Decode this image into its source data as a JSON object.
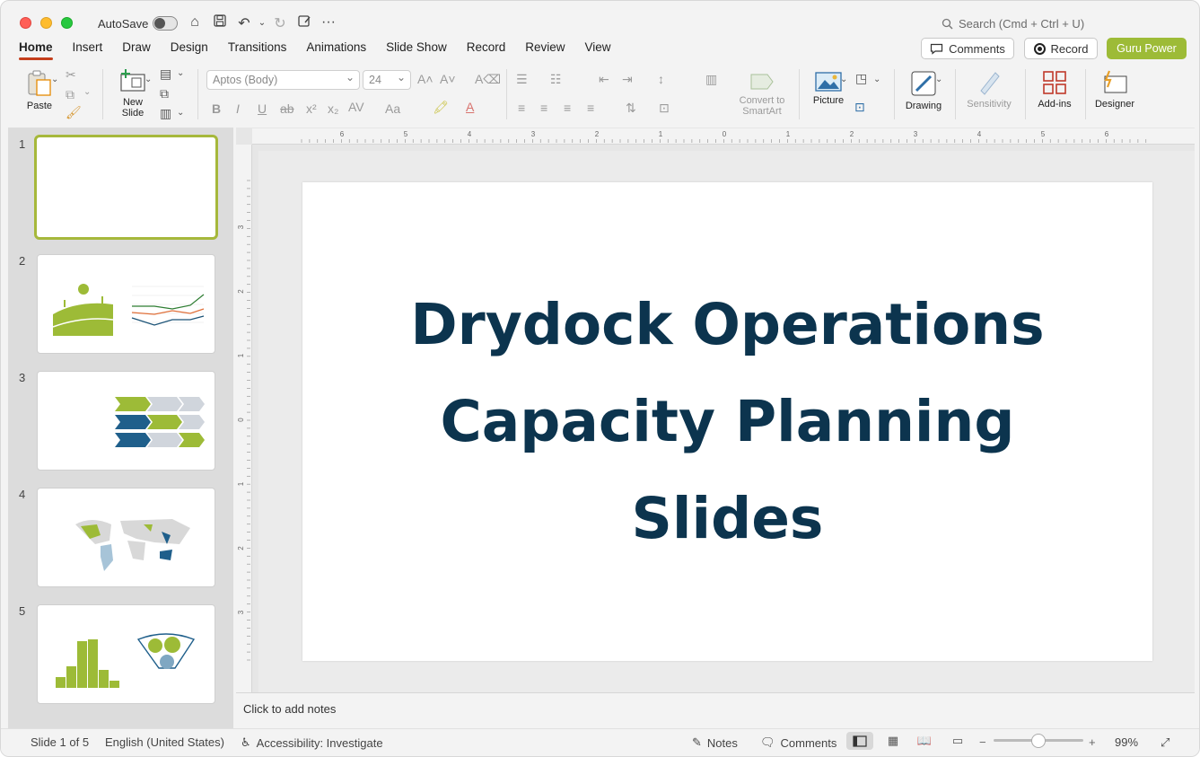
{
  "titlebar": {
    "autosave_label": "AutoSave",
    "search_placeholder": "Search (Cmd + Ctrl + U)"
  },
  "tabs": [
    "Home",
    "Insert",
    "Draw",
    "Design",
    "Transitions",
    "Animations",
    "Slide Show",
    "Record",
    "Review",
    "View"
  ],
  "actions": {
    "comments": "Comments",
    "record": "Record",
    "guru": "Guru Power"
  },
  "ribbon": {
    "paste": "Paste",
    "new_slide_1": "New",
    "new_slide_2": "Slide",
    "font_name": "Aptos (Body)",
    "font_size": "24",
    "convert_1": "Convert to",
    "convert_2": "SmartArt",
    "picture": "Picture",
    "drawing": "Drawing",
    "sensitivity": "Sensitivity",
    "addins": "Add-ins",
    "designer": "Designer"
  },
  "slides": [
    "1",
    "2",
    "3",
    "4",
    "5"
  ],
  "slide": {
    "title_line1": "Drydock Operations",
    "title_line2": "Capacity Planning",
    "title_line3": "Slides",
    "title_color": "#0c344e"
  },
  "notes_placeholder": "Click to add notes",
  "status": {
    "slide_info": "Slide 1 of 5",
    "language": "English (United States)",
    "accessibility": "Accessibility: Investigate",
    "notes": "Notes",
    "comments": "Comments",
    "zoom": "99%"
  },
  "ruler": {
    "h_labels": [
      "6",
      "5",
      "4",
      "3",
      "2",
      "1",
      "0",
      "1",
      "2",
      "3",
      "4",
      "5",
      "6"
    ],
    "v_labels": [
      "3",
      "2",
      "1",
      "0",
      "1",
      "2",
      "3"
    ]
  },
  "colors": {
    "accent_tab": "#c43e1c",
    "guru": "#9dbb37",
    "thumb_selected": "#a6b83b"
  }
}
